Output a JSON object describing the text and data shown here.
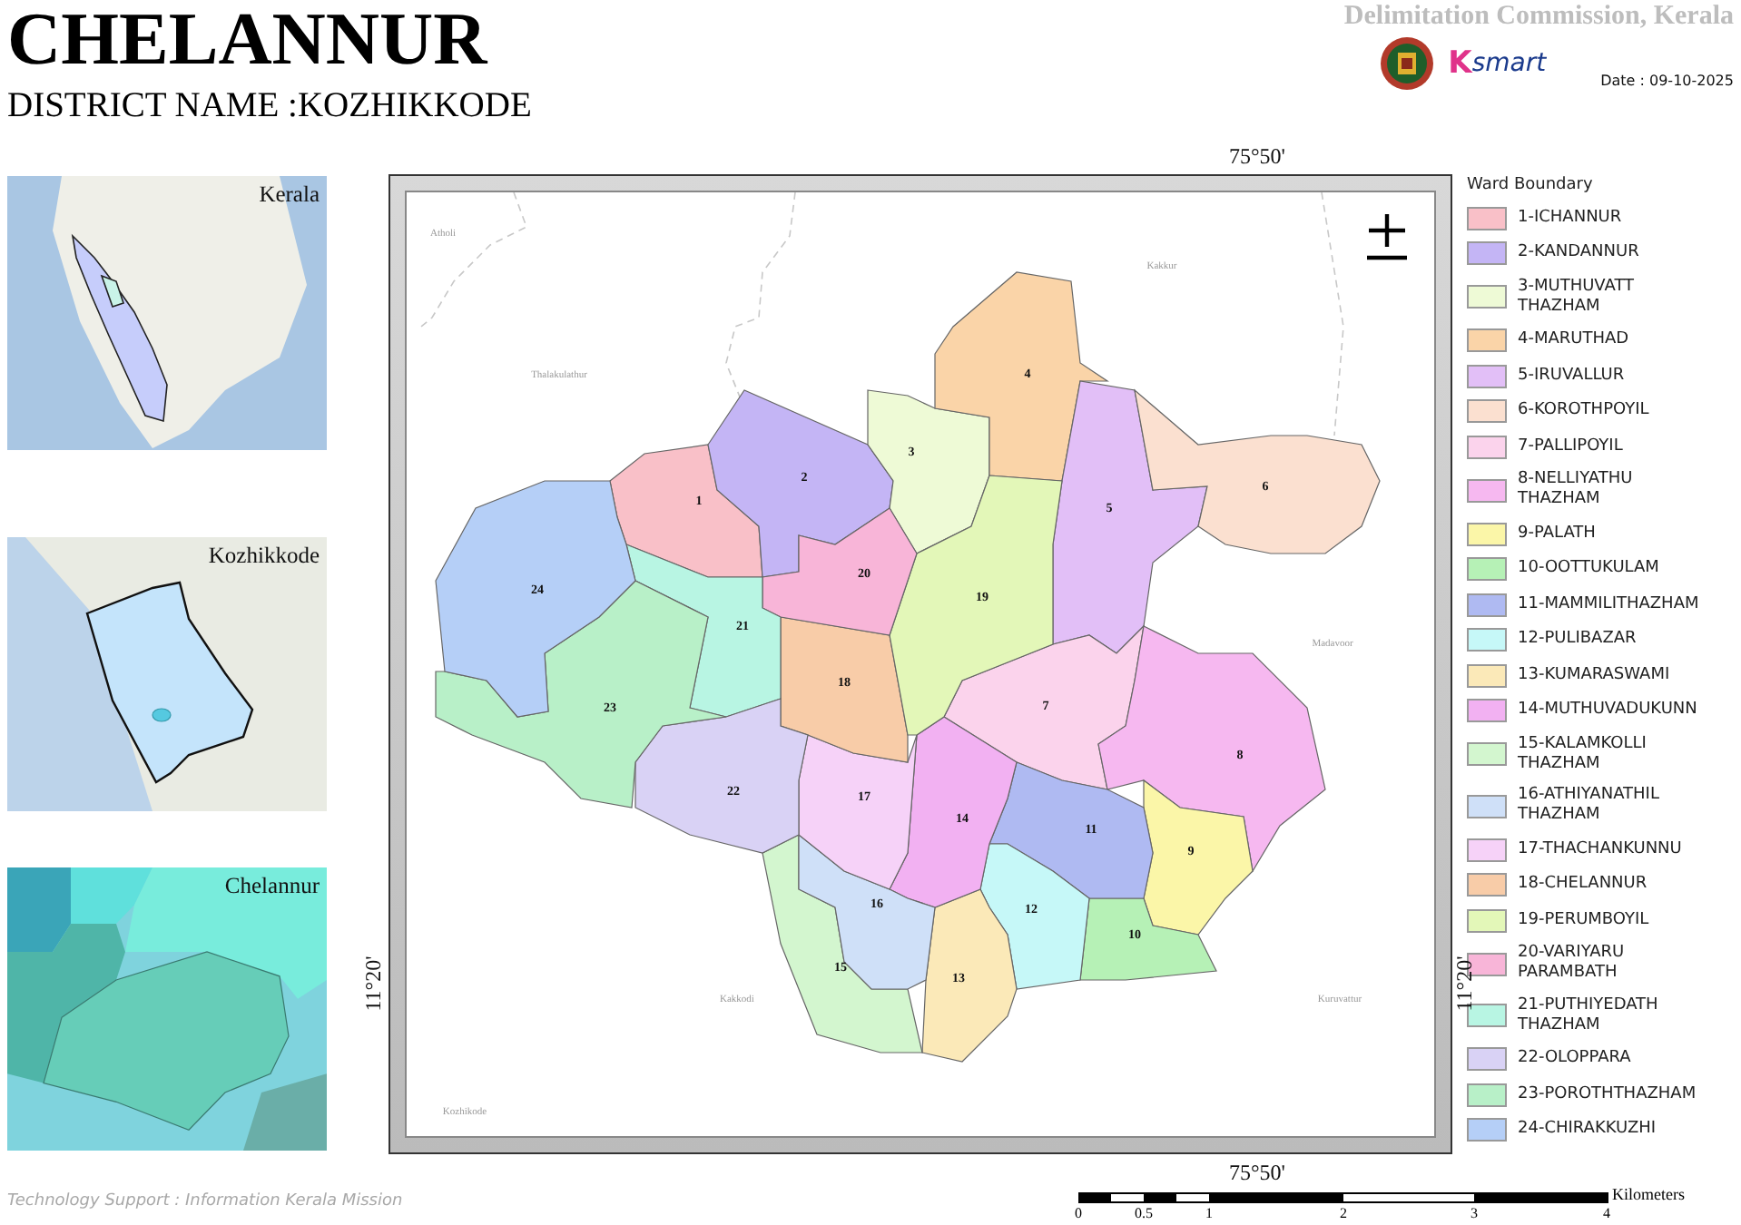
{
  "header": {
    "title": "CHELANNUR",
    "subtitle": "DISTRICT NAME :KOZHIKKODE",
    "agency": "Delimitation Commission, Kerala",
    "logo_prefix": "K",
    "logo_text": "smart",
    "date": "Date : 09-10-2025"
  },
  "inset_maps": [
    {
      "kind": "state",
      "caption": "Kerala"
    },
    {
      "kind": "district",
      "caption": "Kozhikkode"
    },
    {
      "kind": "local",
      "caption": "Chelannur"
    }
  ],
  "map": {
    "graticule": {
      "top": "75°50'",
      "bottom": "75°50'",
      "left": "11°20'",
      "right": "11°20'"
    },
    "place_names": [
      "Atholi",
      "Kakkur",
      "Thalakulathur",
      "Madavoor",
      "Kakkodi",
      "Kuruvattur",
      "Kozhikode"
    ],
    "legend_title": "Ward Boundary",
    "wards": [
      {
        "number": "1",
        "name": "1-ICHANNUR",
        "color": "#f9c0c8"
      },
      {
        "number": "2",
        "name": "2-KANDANNUR",
        "color": "#c4b5f5"
      },
      {
        "number": "3",
        "name": "3-MUTHUVATT THAZHAM",
        "color": "#eefad6"
      },
      {
        "number": "4",
        "name": "4-MARUTHAD",
        "color": "#fad4a8"
      },
      {
        "number": "5",
        "name": "5-IRUVALLUR",
        "color": "#e2bff7"
      },
      {
        "number": "6",
        "name": "6-KOROTHPOYIL",
        "color": "#fbe0d0"
      },
      {
        "number": "7",
        "name": "7-PALLIPOYIL",
        "color": "#fbd3ec"
      },
      {
        "number": "8",
        "name": "8-NELLIYATHU THAZHAM",
        "color": "#f6b8f0"
      },
      {
        "number": "9",
        "name": "9-PALATH",
        "color": "#fbf6a8"
      },
      {
        "number": "10",
        "name": "10-OOTTUKULAM",
        "color": "#b6f1b6"
      },
      {
        "number": "11",
        "name": "11-MAMMILITHAZHAM",
        "color": "#afbaf2"
      },
      {
        "number": "12",
        "name": "12-PULIBAZAR",
        "color": "#c6f8f8"
      },
      {
        "number": "13",
        "name": "13-KUMARASWAMI",
        "color": "#fbe9b8"
      },
      {
        "number": "14",
        "name": "14-MUTHUVADUKUNN",
        "color": "#f2b1f2"
      },
      {
        "number": "15",
        "name": "15-KALAMKOLLI THAZHAM",
        "color": "#d3f6cf"
      },
      {
        "number": "16",
        "name": "16-ATHIYANATHIL THAZHAM",
        "color": "#cfe0f8"
      },
      {
        "number": "17",
        "name": "17-THACHANKUNNU",
        "color": "#f6d2f8"
      },
      {
        "number": "18",
        "name": "18-CHELANNUR",
        "color": "#f8cca8"
      },
      {
        "number": "19",
        "name": "19-PERUMBOYIL",
        "color": "#e3f7b8"
      },
      {
        "number": "20",
        "name": "20-VARIYARU PARAMBATH",
        "color": "#f8b5d8"
      },
      {
        "number": "21",
        "name": "21-PUTHIYEDATH THAZHAM",
        "color": "#b8f5e3"
      },
      {
        "number": "22",
        "name": "22-OLOPPARA",
        "color": "#d9d2f5"
      },
      {
        "number": "23",
        "name": "23-POROTHTHAZHAM",
        "color": "#b8f0c8"
      },
      {
        "number": "24",
        "name": "24-CHIRAKKUZHI",
        "color": "#b5cff7"
      }
    ]
  },
  "scale_bar": {
    "unit": "Kilometers",
    "ticks": [
      "0",
      "0.5",
      "1",
      "2",
      "3",
      "4"
    ]
  },
  "footer": {
    "credit": "Technology Support : Information Kerala Mission"
  }
}
